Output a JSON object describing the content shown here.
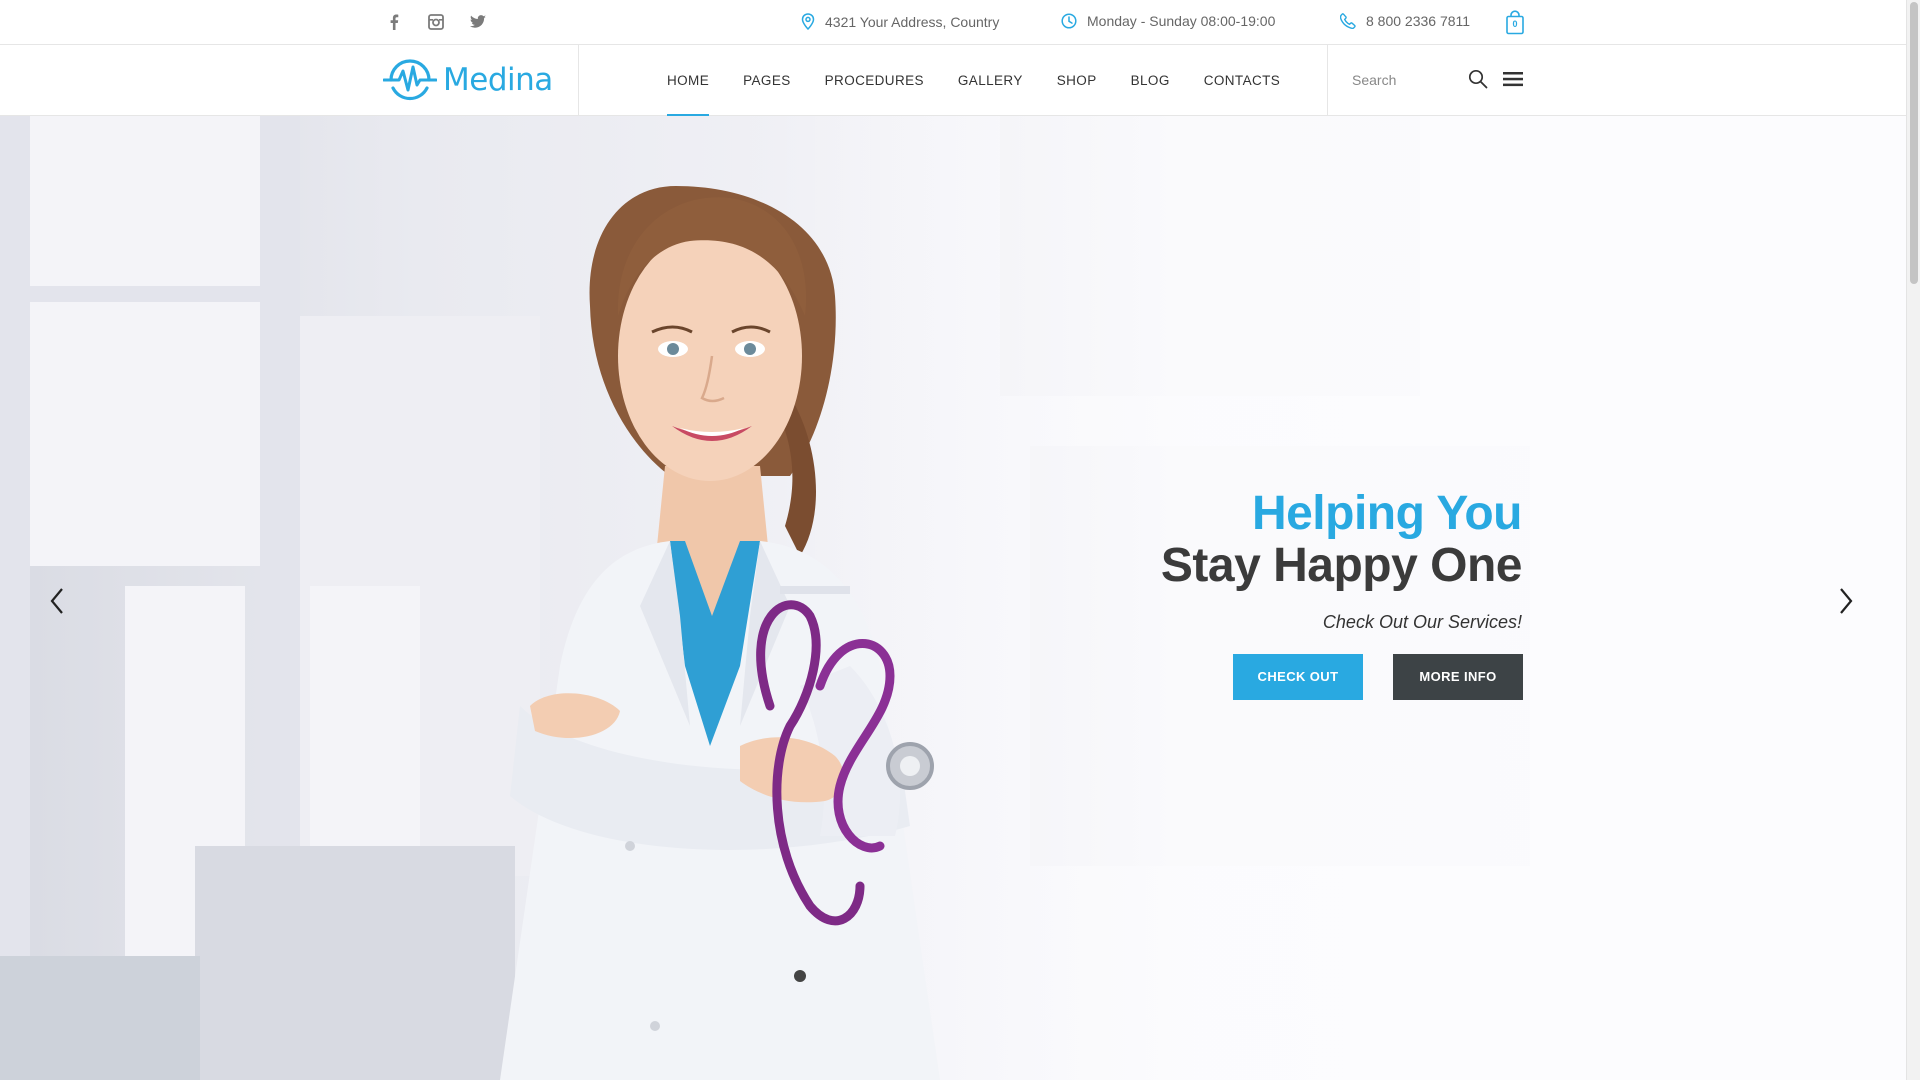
{
  "topbar": {
    "social": [
      "facebook-icon",
      "instagram-icon",
      "twitter-icon"
    ],
    "address": "4321 Your Address, Country",
    "hours": "Monday - Sunday 08:00-19:00",
    "phone": "8 800 2336 7811",
    "cart_count": "0"
  },
  "header": {
    "logo_text": "Medina",
    "nav": [
      "HOME",
      "PAGES",
      "PROCEDURES",
      "GALLERY",
      "SHOP",
      "BLOG",
      "CONTACTS"
    ],
    "active_nav": "HOME",
    "search_placeholder": "Search"
  },
  "hero": {
    "title_line1": "Helping You",
    "title_line2": "Stay Happy One",
    "subtitle": "Check Out Our Services!",
    "btn_primary": "CHECK OUT",
    "btn_secondary": "MORE INFO"
  },
  "colors": {
    "accent": "#29a9e1",
    "dark": "#3b3b3b",
    "button_dark": "#3d4346"
  }
}
